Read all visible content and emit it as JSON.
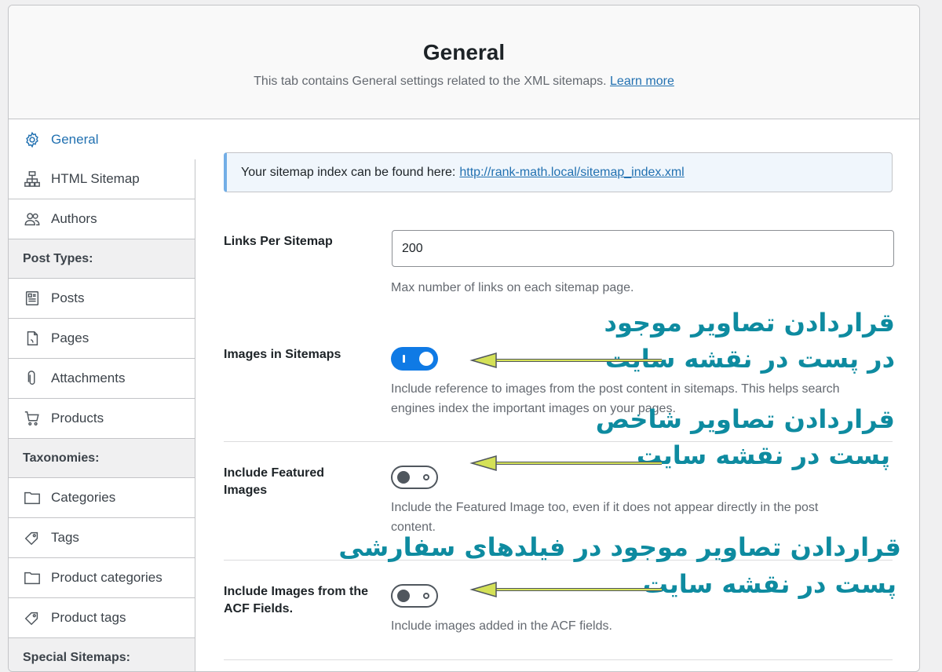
{
  "header": {
    "title": "General",
    "description": "This tab contains General settings related to the XML sitemaps.",
    "learn_more": "Learn more"
  },
  "sidebar": {
    "items": [
      {
        "label": "General",
        "icon": "gear-icon",
        "active": true
      },
      {
        "label": "HTML Sitemap",
        "icon": "sitemap-icon"
      },
      {
        "label": "Authors",
        "icon": "users-icon"
      }
    ],
    "post_types_heading": "Post Types:",
    "post_types": [
      {
        "label": "Posts",
        "icon": "post-icon"
      },
      {
        "label": "Pages",
        "icon": "page-icon"
      },
      {
        "label": "Attachments",
        "icon": "paperclip-icon"
      },
      {
        "label": "Products",
        "icon": "cart-icon"
      }
    ],
    "taxonomies_heading": "Taxonomies:",
    "taxonomies": [
      {
        "label": "Categories",
        "icon": "folder-icon"
      },
      {
        "label": "Tags",
        "icon": "tag-icon"
      },
      {
        "label": "Product categories",
        "icon": "folder-icon"
      },
      {
        "label": "Product tags",
        "icon": "tag-icon"
      }
    ],
    "special_heading": "Special Sitemaps:"
  },
  "notice": {
    "text": "Your sitemap index can be found here:",
    "link": "http://rank-math.local/sitemap_index.xml"
  },
  "settings": {
    "links_per_sitemap": {
      "label": "Links Per Sitemap",
      "value": "200",
      "desc": "Max number of links on each sitemap page."
    },
    "images_in_sitemaps": {
      "label": "Images in Sitemaps",
      "enabled": true,
      "desc_line1": "Include reference to images from the post content in sitemaps. This helps search",
      "desc_line2": "engines index the important images on your pages."
    },
    "featured_images": {
      "label_line1": "Include Featured",
      "label_line2": "Images",
      "enabled": false,
      "desc_line1": "Include the Featured Image too, even if it does not appear directly in the post",
      "desc_line2": "content."
    },
    "acf_images": {
      "label_line1": "Include Images from the",
      "label_line2": "ACF Fields.",
      "enabled": false,
      "desc": "Include images added in the ACF fields."
    }
  },
  "annotations": {
    "a1_line1": "قراردادن تصاویر موجود",
    "a1_line2": "در پست در نقشه سایت",
    "a2_line1": "قراردادن تصاویر شاخص",
    "a2_line2": "پست در نقشه سایت",
    "a3_line1": "قراردادن تصاویر موجود در فیلدهای سفارشی",
    "a3_line2": "پست در نقشه سایت",
    "arrow_color": "#d4e157"
  },
  "colors": {
    "accent": "#2271b1",
    "toggle_on": "#0f7ae5",
    "annotation_text": "#0e8ba0"
  }
}
